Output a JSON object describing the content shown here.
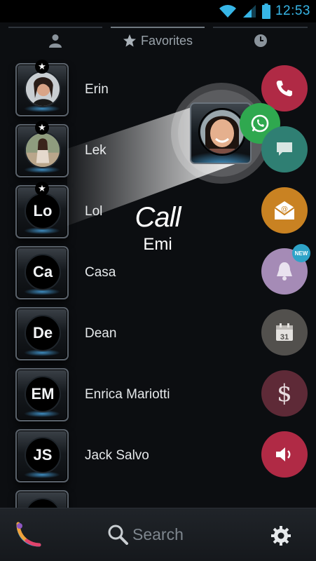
{
  "status": {
    "time": "12:53"
  },
  "tabs": [
    {
      "name": "contacts",
      "icon": "person-icon",
      "label": ""
    },
    {
      "name": "favorites",
      "icon": "star-icon",
      "label": "Favorites"
    },
    {
      "name": "recents",
      "icon": "clock-icon",
      "label": ""
    }
  ],
  "contacts": [
    {
      "name": "Erin",
      "initials": "",
      "favorite": true,
      "photo": true
    },
    {
      "name": "Lek",
      "initials": "",
      "favorite": true,
      "photo": true
    },
    {
      "name": "Lol",
      "initials": "Lo",
      "favorite": true,
      "photo": false
    },
    {
      "name": "Casa",
      "initials": "Ca",
      "favorite": false,
      "photo": false
    },
    {
      "name": "Dean",
      "initials": "De",
      "favorite": false,
      "photo": false
    },
    {
      "name": "Enrica Mariotti",
      "initials": "EM",
      "favorite": false,
      "photo": false
    },
    {
      "name": "Jack Salvo",
      "initials": "JS",
      "favorite": false,
      "photo": false
    }
  ],
  "callout": {
    "action": "Call",
    "contact": "Emi"
  },
  "actions": [
    {
      "name": "call",
      "icon": "phone-icon",
      "color": "#b02a45"
    },
    {
      "name": "whatsapp",
      "icon": "whatsapp-icon",
      "color": "#2fa84f"
    },
    {
      "name": "message",
      "icon": "chat-bubble-icon",
      "color": "#2f7f73"
    },
    {
      "name": "email",
      "icon": "envelope-icon",
      "color": "#c98222"
    },
    {
      "name": "reminder",
      "icon": "bell-icon",
      "color": "#a58bb6",
      "badge": "NEW"
    },
    {
      "name": "calendar",
      "icon": "calendar-icon",
      "color": "#52504d",
      "day": "31"
    },
    {
      "name": "payment",
      "icon": "dollar-icon",
      "color": "#5e2a37",
      "symbol": "$"
    },
    {
      "name": "speaker",
      "icon": "speaker-icon",
      "color": "#b02a45"
    }
  ],
  "bottom": {
    "search_placeholder": "Search"
  },
  "colors": {
    "accent": "#37b6e7",
    "background": "#0c0e11"
  }
}
